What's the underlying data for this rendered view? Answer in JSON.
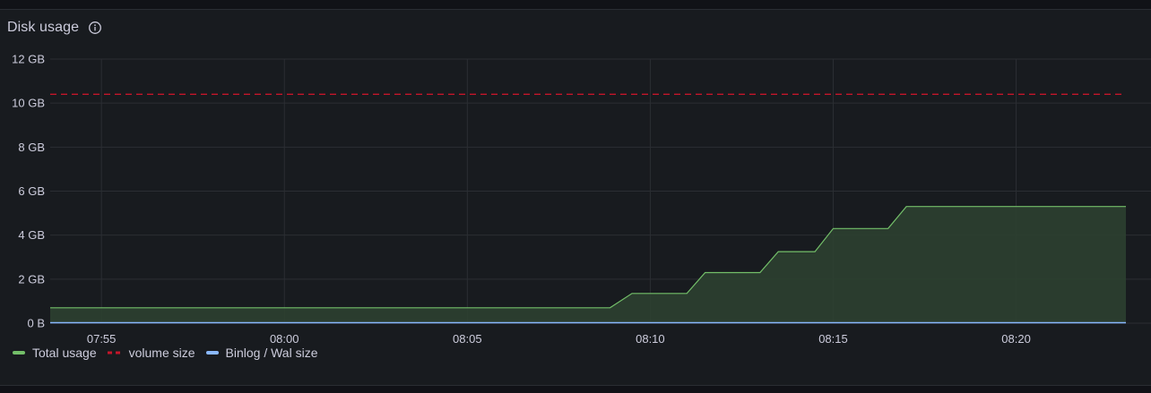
{
  "panel": {
    "title": "Disk usage",
    "info_icon": "info-circle-icon"
  },
  "colors": {
    "total_usage": "#73bf69",
    "total_fill": "#2c4030",
    "volume_size": "#c4162a",
    "binlog": "#8ab8ff",
    "grid": "#2b2e33",
    "text": "#ccccdc"
  },
  "legend": [
    {
      "label": "Total usage",
      "color": "#73bf69",
      "style": "solid"
    },
    {
      "label": "volume size",
      "color": "#c4162a",
      "style": "dashed"
    },
    {
      "label": "Binlog / Wal size",
      "color": "#8ab8ff",
      "style": "solid"
    }
  ],
  "chart_data": {
    "type": "area",
    "title": "Disk usage",
    "xlabel": "",
    "ylabel": "",
    "x_ticks": [
      "07:55",
      "08:00",
      "08:05",
      "08:10",
      "08:15",
      "08:20"
    ],
    "y_ticks": [
      "0 B",
      "2 GB",
      "4 GB",
      "6 GB",
      "8 GB",
      "10 GB",
      "12 GB"
    ],
    "xlim": [
      "07:53:36",
      "08:23:00"
    ],
    "ylim": [
      0,
      12
    ],
    "y_unit": "GB",
    "grid": true,
    "legend_position": "bottom-left",
    "series": [
      {
        "name": "Total usage",
        "style": "solid-area",
        "points": [
          [
            "07:53:36",
            0.7
          ],
          [
            "08:08:54",
            0.7
          ],
          [
            "08:09:30",
            1.35
          ],
          [
            "08:10:30",
            1.35
          ],
          [
            "08:11:00",
            1.35
          ],
          [
            "08:11:30",
            2.3
          ],
          [
            "08:12:30",
            2.3
          ],
          [
            "08:13:00",
            2.3
          ],
          [
            "08:13:30",
            3.25
          ],
          [
            "08:14:00",
            3.25
          ],
          [
            "08:14:30",
            3.25
          ],
          [
            "08:15:00",
            4.3
          ],
          [
            "08:16:00",
            4.3
          ],
          [
            "08:16:30",
            4.3
          ],
          [
            "08:17:00",
            5.3
          ],
          [
            "08:23:00",
            5.3
          ]
        ]
      },
      {
        "name": "volume size",
        "style": "dashed",
        "points": [
          [
            "07:53:36",
            10.4
          ],
          [
            "08:23:00",
            10.4
          ]
        ]
      },
      {
        "name": "Binlog / Wal size",
        "style": "solid",
        "points": [
          [
            "07:53:36",
            0.02
          ],
          [
            "08:23:00",
            0.02
          ]
        ]
      }
    ]
  }
}
